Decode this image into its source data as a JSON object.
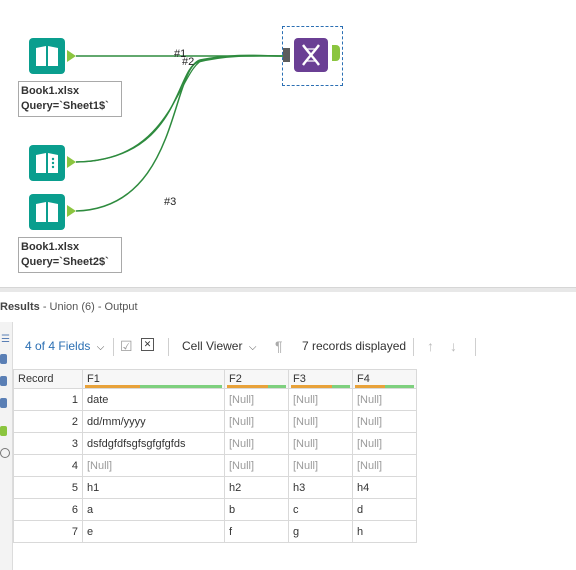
{
  "canvas": {
    "connections": [
      {
        "label": "#1"
      },
      {
        "label": "#2"
      },
      {
        "label": "#3"
      }
    ],
    "tools": [
      {
        "name": "Book1.xlsx",
        "query": "Query=`Sheet1$`"
      },
      {
        "name": "Book1.xlsx",
        "query": "Query=`Sheet2$`"
      }
    ],
    "union_tool": "dna-union-icon"
  },
  "results": {
    "prefix": "Results",
    "source": "- Union (6) - Output"
  },
  "toolbar": {
    "fields": "4 of 4 Fields",
    "cell_viewer": "Cell Viewer",
    "records": "7 records displayed"
  },
  "table": {
    "headers": [
      "Record",
      "F1",
      "F2",
      "F3",
      "F4"
    ],
    "rows": [
      {
        "rec": "1",
        "f1": "date",
        "f2": "[Null]",
        "f3": "[Null]",
        "f4": "[Null]"
      },
      {
        "rec": "2",
        "f1": "dd/mm/yyyy",
        "f2": "[Null]",
        "f3": "[Null]",
        "f4": "[Null]"
      },
      {
        "rec": "3",
        "f1": "dsfdgfdfsgfsgfgfgfds",
        "f2": "[Null]",
        "f3": "[Null]",
        "f4": "[Null]"
      },
      {
        "rec": "4",
        "f1": "[Null]",
        "f2": "[Null]",
        "f3": "[Null]",
        "f4": "[Null]"
      },
      {
        "rec": "5",
        "f1": "h1",
        "f2": "h2",
        "f3": "h3",
        "f4": "h4"
      },
      {
        "rec": "6",
        "f1": "a",
        "f2": "b",
        "f3": "c",
        "f4": "d"
      },
      {
        "rec": "7",
        "f1": "e",
        "f2": "f",
        "f3": "g",
        "f4": "h"
      }
    ]
  },
  "colors": {
    "input_tool": "#0a9e8e",
    "union_tool": "#6a3f94",
    "anchor": "#8bc53f",
    "connection": "#2e8b3e",
    "null_text": "#9a9a9a"
  }
}
